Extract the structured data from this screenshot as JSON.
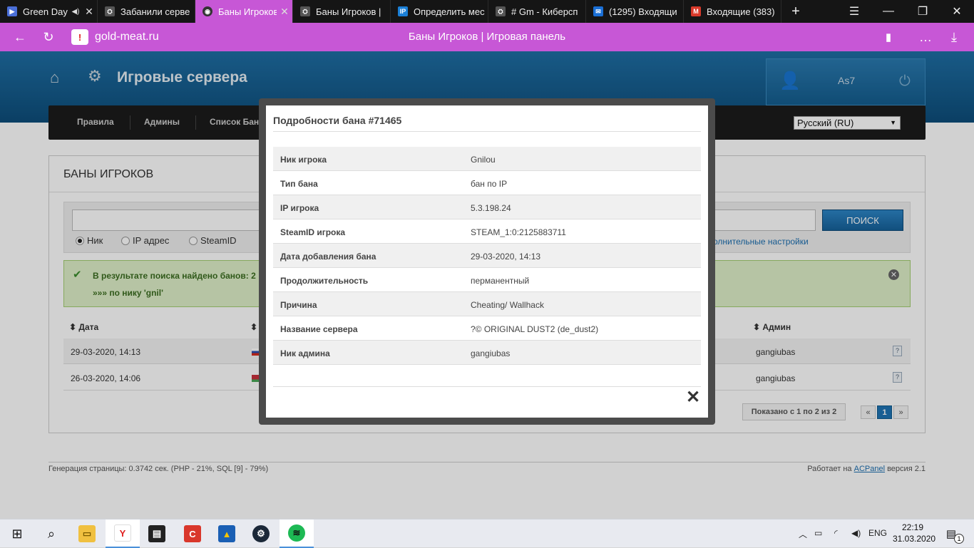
{
  "browser": {
    "tabs": [
      {
        "label": "Green Day",
        "icon": "youtube-icon",
        "color": "#4a6fd8"
      },
      {
        "label": "Забанили серве",
        "icon": "favicon-icon",
        "color": "#666666"
      },
      {
        "label": "Баны Игроков",
        "icon": "favicon-icon",
        "color": "#ffffff",
        "active": true
      },
      {
        "label": "Баны Игроков |",
        "icon": "favicon-icon",
        "color": "#666666"
      },
      {
        "label": "Определить мес",
        "icon": "ip-icon",
        "color": "#1a7fd6"
      },
      {
        "label": "# Gm - Киберсп",
        "icon": "favicon-icon",
        "color": "#666666"
      },
      {
        "label": "(1295) Входящи",
        "icon": "mail-icon",
        "color": "#1a6fd6"
      },
      {
        "label": "Входящие (383)",
        "icon": "gmail-icon",
        "color": "#d93a2b"
      }
    ],
    "domain": "gold-meat.ru",
    "page_title": "Баны Игроков | Игровая панель"
  },
  "header": {
    "site_title": "Игровые сервера",
    "username": "As7"
  },
  "nav": {
    "items": [
      "Правила",
      "Админы",
      "Список Банов"
    ],
    "language": "Русский (RU)"
  },
  "content": {
    "heading": "БАНЫ ИГРОКОВ",
    "search_button": "ПОИСК",
    "radios": [
      "Ник",
      "IP адрес",
      "SteamID"
    ],
    "advanced_link": "олнительные настройки",
    "alert_line1": "В результате поиска найдено банов: 2",
    "alert_line2": "»»» по нику 'gnil'",
    "col_date": "Дата",
    "col_admin": "Админ",
    "col_nick_initial": "Н",
    "rows": [
      {
        "date": "29-03-2020, 14:13",
        "admin": "gangiubas"
      },
      {
        "date": "26-03-2020, 14:06",
        "admin": "gangiubas"
      }
    ],
    "shown": "Показано с 1 по 2 из 2",
    "pages": [
      "«",
      "1",
      "»"
    ]
  },
  "footer": {
    "left": "Генерация страницы: 0.3742 сек. (PHP - 21%, SQL [9] - 79%)",
    "right_prefix": "Работает на ",
    "right_link": "ACPanel",
    "right_suffix": " версия 2.1"
  },
  "modal": {
    "title": "Подробности бана #71465",
    "rows": [
      {
        "key": "Ник игрока",
        "value": "Gnilou"
      },
      {
        "key": "Тип бана",
        "value": "бан по IP"
      },
      {
        "key": "IP игрока",
        "value": "5.3.198.24"
      },
      {
        "key": "SteamID игрока",
        "value": "STEAM_1:0:2125883711"
      },
      {
        "key": "Дата добавления бана",
        "value": "29-03-2020, 14:13"
      },
      {
        "key": "Продолжительность",
        "value": "перманентный"
      },
      {
        "key": "Причина",
        "value": "Cheating/ Wallhack"
      },
      {
        "key": "Название сервера",
        "value": "?© ORIGINAL DUST2 (de_dust2)"
      },
      {
        "key": "Ник админа",
        "value": "gangiubas"
      }
    ]
  },
  "taskbar": {
    "lang": "ENG",
    "time": "22:19",
    "date": "31.03.2020",
    "notifications": "1"
  }
}
